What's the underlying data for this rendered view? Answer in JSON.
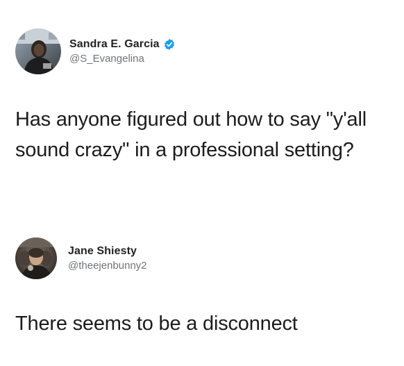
{
  "tweets": [
    {
      "author": {
        "display_name": "Sandra E. Garcia",
        "handle": "@S_Evangelina",
        "verified": true,
        "avatar_icon": "profile-photo"
      },
      "text": "Has anyone figured out how to say \"y'all sound crazy\" in a professional setting?"
    },
    {
      "author": {
        "display_name": "Jane Shiesty",
        "handle": "@theejenbunny2",
        "verified": false,
        "avatar_icon": "profile-photo"
      },
      "text": "There seems to be a disconnect"
    }
  ],
  "colors": {
    "verified_badge": "#1d9bf0",
    "handle_text": "#6e7479",
    "body_text": "#1c1c1c"
  }
}
